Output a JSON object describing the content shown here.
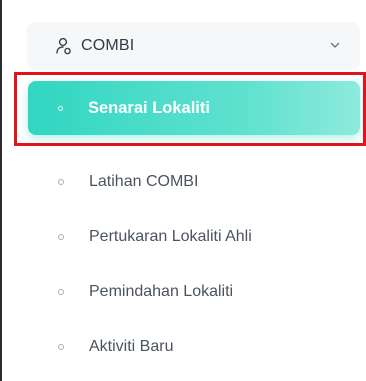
{
  "menu": {
    "group": {
      "icon": "users-icon",
      "label": "COMBI",
      "chevron": "chevron-down-icon"
    },
    "active": {
      "label": "Senarai Lokaliti"
    },
    "items": [
      {
        "label": "Latihan COMBI"
      },
      {
        "label": "Pertukaran Lokaliti Ahli"
      },
      {
        "label": "Pemindahan Lokaliti"
      },
      {
        "label": "Aktiviti Baru"
      }
    ]
  },
  "colors": {
    "active_gradient_start": "#31d6c1",
    "active_gradient_end": "#8eeadc",
    "highlight_border": "#e0141b",
    "header_bg": "#f6f7f9"
  }
}
